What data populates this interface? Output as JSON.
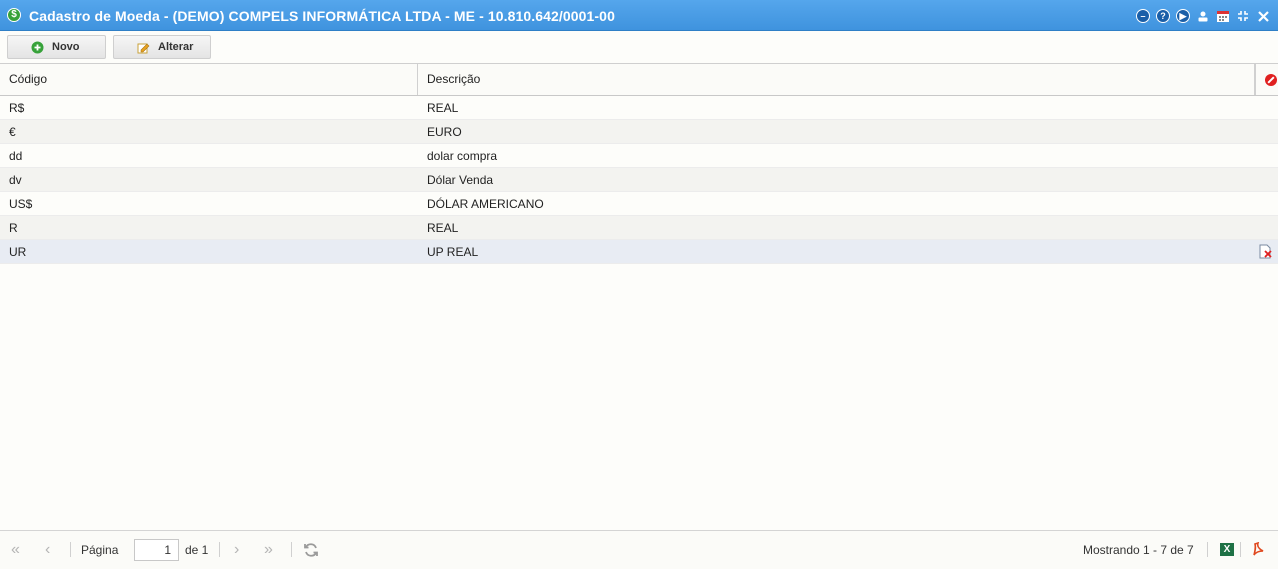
{
  "window": {
    "title": "Cadastro de Moeda - (DEMO) COMPELS INFORMÁTICA LTDA - ME - 10.810.642/0001-00",
    "app_icon_glyph": "$",
    "title_icons": [
      "minimize-icon",
      "help-icon",
      "play-icon",
      "user-icon",
      "calendar-icon",
      "compress-icon",
      "close-icon"
    ]
  },
  "toolbar": {
    "novo_label": "Novo",
    "alterar_label": "Alterar"
  },
  "grid": {
    "columns": [
      "Código",
      "Descrição"
    ],
    "rows": [
      {
        "codigo": "R$",
        "descricao": "REAL"
      },
      {
        "codigo": "€",
        "descricao": "EURO"
      },
      {
        "codigo": "dd",
        "descricao": "dolar compra"
      },
      {
        "codigo": "dv",
        "descricao": "Dólar Venda"
      },
      {
        "codigo": "US$",
        "descricao": "DÓLAR AMERICANO"
      },
      {
        "codigo": "R",
        "descricao": "REAL"
      },
      {
        "codigo": "UR",
        "descricao": "UP REAL"
      }
    ],
    "selected_row_index": 6
  },
  "pagination": {
    "page_label": "Página",
    "page_value": "1",
    "of_label": "de 1",
    "showing": "Mostrando 1 - 7 de 7"
  },
  "colors": {
    "titlebar": "#4a9de6",
    "accent_green": "#37a23a",
    "delete_red": "#e02020"
  }
}
